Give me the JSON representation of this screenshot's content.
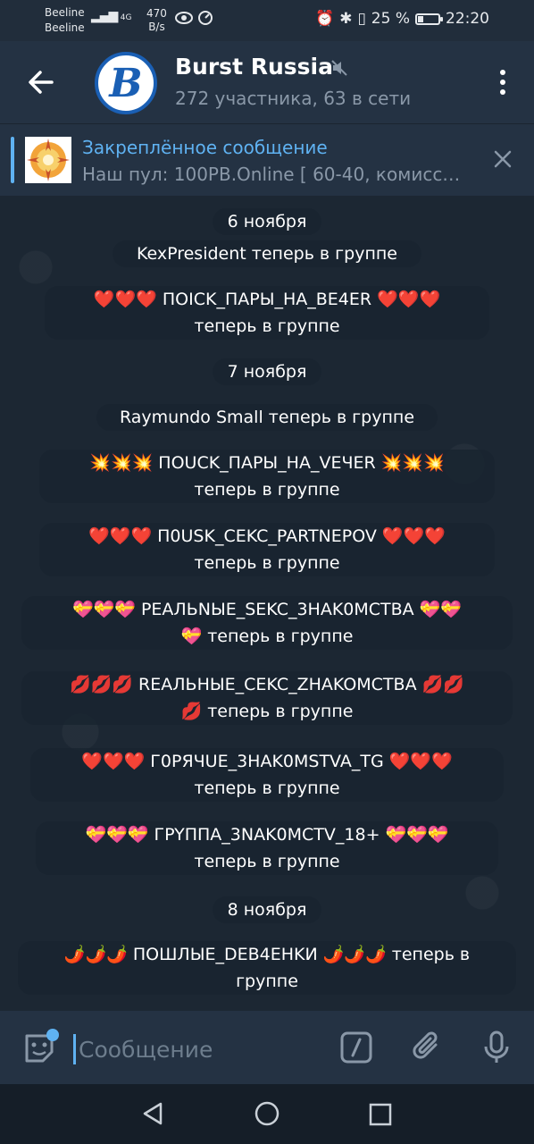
{
  "status_bar": {
    "carrier_1": "Beeline",
    "carrier_2": "Beeline",
    "signal": "4G",
    "net_speed_value": "470",
    "net_speed_unit": "B/s",
    "battery_percent": "25 %",
    "battery_level": 0.25,
    "time": "22:20"
  },
  "header": {
    "title": "Burst Russia",
    "subtitle": "272 участника, 63 в сети",
    "avatar_letter": "B"
  },
  "pinned": {
    "title": "Закреплённое сообщение",
    "text": "Наш пул: 100PB.Online [ 60-40, комисс…"
  },
  "messages": [
    {
      "type": "date",
      "text": "6 ноября"
    },
    {
      "type": "service",
      "line1": "KexPresident теперь в группе"
    },
    {
      "type": "service",
      "line1": "❤️❤️❤️ ПOICK_ПAPЫ_HA_BE4ER ❤️❤️❤️",
      "line2": "теперь в группе"
    },
    {
      "type": "date",
      "text": "7 ноября"
    },
    {
      "type": "service",
      "line1": "Raymundo Small теперь в группе"
    },
    {
      "type": "service",
      "line1": "💥💥💥 ПOUCK_ПAPЫ_HA_VEЧER 💥💥💥",
      "line2": "теперь в группе"
    },
    {
      "type": "service",
      "line1": "❤️❤️❤️ П0USK_CEKC_PARTNEPOV ❤️❤️❤️",
      "line2": "теперь в группе"
    },
    {
      "type": "service",
      "line1": "💝💝💝 PEAЛЬNЫE_SEKC_3HAK0MCTBA 💝💝",
      "line2": "💝 теперь в группе"
    },
    {
      "type": "service",
      "line1": "💋💋💋 REAЛЬНЫE_CEKC_ZHAKOMCTBA 💋💋",
      "line2": "💋 теперь в группе"
    },
    {
      "type": "service",
      "line1": "❤️❤️❤️ Г0PЯЧUE_3HAK0MSTVA_TG ❤️❤️❤️",
      "line2": "теперь в группе"
    },
    {
      "type": "service",
      "line1": "💝💝💝 ГPYППA_3NAK0MCTV_18+ 💝💝💝",
      "line2": "теперь в группе"
    },
    {
      "type": "date",
      "text": "8 ноября"
    },
    {
      "type": "service",
      "line1": "🌶️🌶️🌶️ ПOШЛЫE_DEB4EHKИ 🌶️🌶️🌶️ теперь в",
      "line2": "группе"
    }
  ],
  "composer": {
    "placeholder": "Сообщение"
  },
  "icons": {
    "back": "arrow-left-icon",
    "mute": "muted-speaker-icon",
    "menu": "vertical-dots-icon",
    "close": "close-icon",
    "emoji": "sticker-emoji-icon",
    "commands": "slash-command-icon",
    "attach": "paperclip-icon",
    "mic": "microphone-icon"
  },
  "colors": {
    "accent": "#5fb2f2",
    "header_bg": "#243243",
    "chat_bg": "#1c2733",
    "bubble_bg": "#192430",
    "avatar_ring": "#1a5fb4"
  }
}
